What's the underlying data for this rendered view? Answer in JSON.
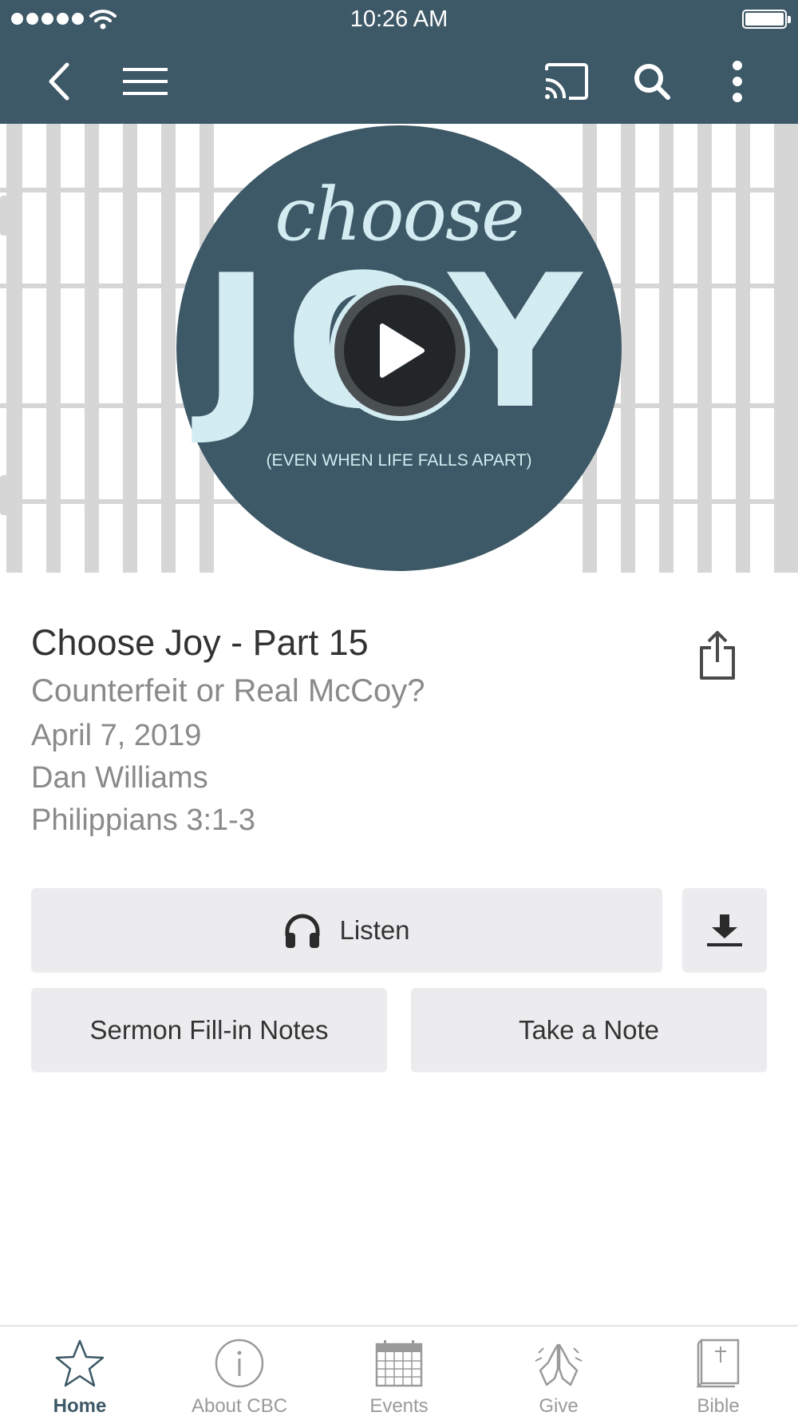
{
  "status_bar": {
    "time": "10:26 AM"
  },
  "hero": {
    "script_word": "choose",
    "big_word": "JOY",
    "tagline": "(EVEN WHEN LIFE FALLS APART)"
  },
  "sermon": {
    "title": "Choose Joy - Part 15",
    "subtitle": "Counterfeit or Real McCoy?",
    "date": "April 7, 2019",
    "speaker": "Dan Williams",
    "scripture": "Philippians 3:1-3"
  },
  "buttons": {
    "listen": "Listen",
    "fill_in_notes": "Sermon Fill-in Notes",
    "take_note": "Take a Note"
  },
  "tabs": [
    {
      "label": "Home",
      "icon": "star-icon",
      "active": true
    },
    {
      "label": "About CBC",
      "icon": "info-icon",
      "active": false
    },
    {
      "label": "Events",
      "icon": "calendar-icon",
      "active": false
    },
    {
      "label": "Give",
      "icon": "praying-hands-icon",
      "active": false
    },
    {
      "label": "Bible",
      "icon": "bible-icon",
      "active": false
    }
  ],
  "colors": {
    "nav_bg": "#3d5866",
    "logo_text": "#d2ecf2",
    "button_bg": "#ececef",
    "active_tab": "#3d5866",
    "inactive_tab": "#9a9a9a"
  }
}
